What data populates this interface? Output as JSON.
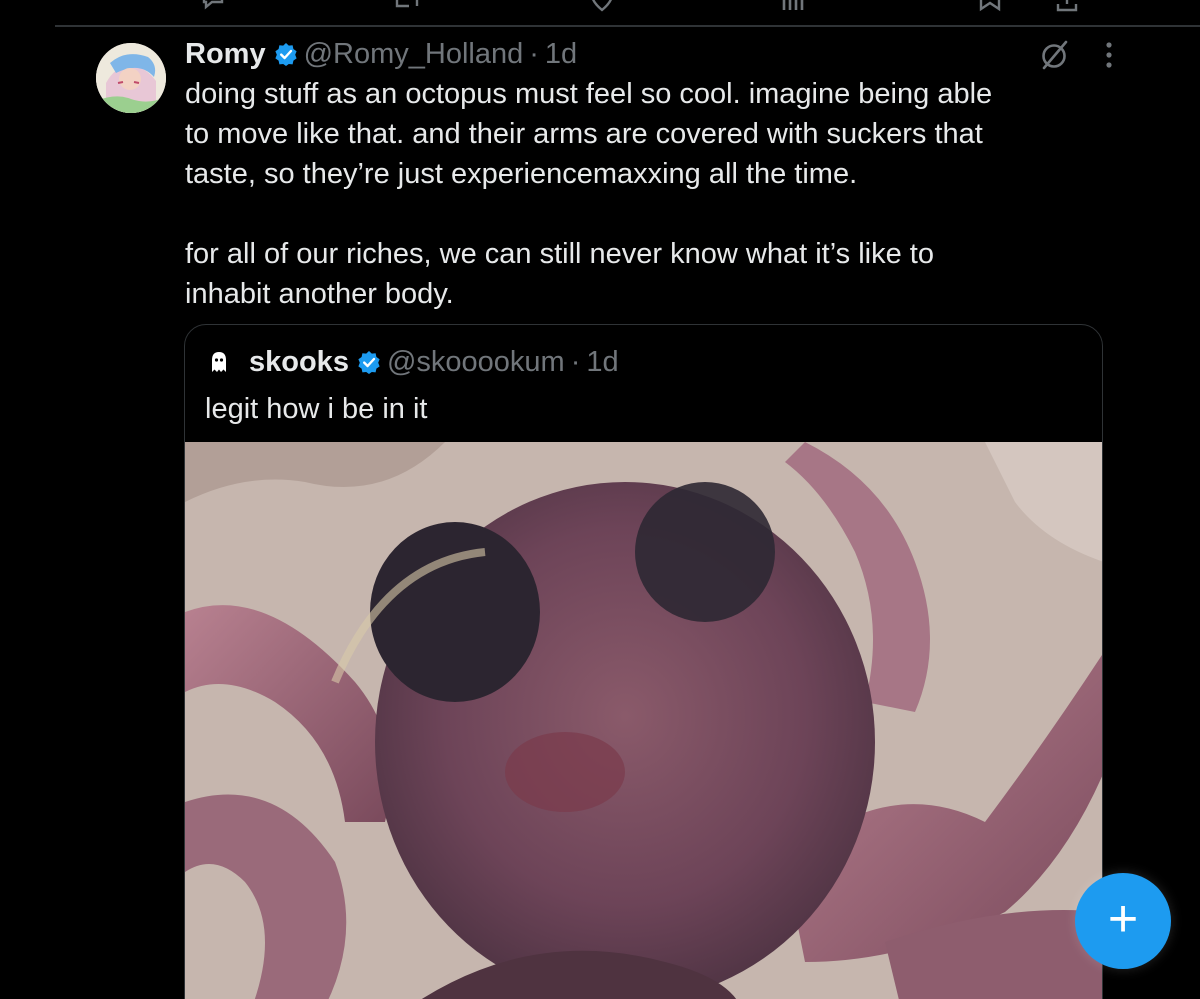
{
  "top_actions": {
    "reply_count": "",
    "retweet_count": "",
    "like_count": "",
    "views_count": ""
  },
  "tweet": {
    "display_name": "Romy",
    "handle": "@Romy_Holland",
    "separator": "·",
    "time": "1d",
    "text_para_1_lines": [
      "doing stuff as an octopus must feel so cool. imagine being able",
      "to move like that. and their arms are covered with suckers that",
      "taste, so they’re just experiencemaxxing all the time."
    ],
    "text_para_2_lines": [
      "for all of our riches, we can still never know what it’s like to",
      "inhabit another body."
    ],
    "icons": {
      "verified": "verified-badge-icon",
      "grok": "grok-icon",
      "more": "more-options-icon"
    }
  },
  "quote": {
    "display_name": "skooks",
    "handle": "@skooookum",
    "separator": "·",
    "time": "1d",
    "text": "legit how i be in it",
    "avatar_icon": "ghost-icon",
    "media_description_icon": "video-media"
  },
  "fab": {
    "glyph": "+",
    "icon": "compose-plus-icon"
  },
  "colors": {
    "background": "#000000",
    "text_primary": "#e7e9ea",
    "text_secondary": "#71767b",
    "accent": "#1d9bf0",
    "border": "#2f3336"
  }
}
